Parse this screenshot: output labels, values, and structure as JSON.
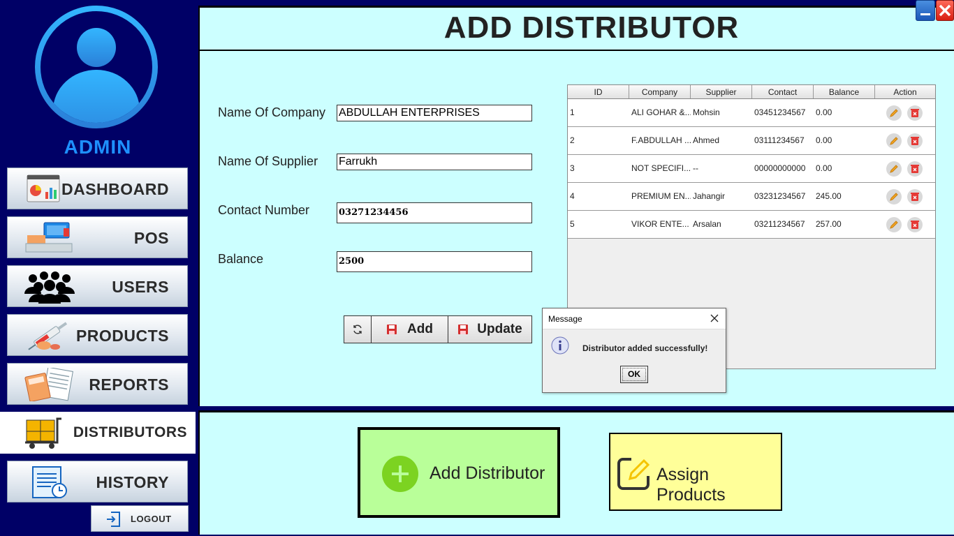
{
  "sidebar": {
    "user_label": "ADMIN",
    "items": [
      {
        "label": "DASHBOARD",
        "icon": "dashboard-icon"
      },
      {
        "label": "POS",
        "icon": "pos-register-icon"
      },
      {
        "label": "USERS",
        "icon": "users-group-icon"
      },
      {
        "label": "PRODUCTS",
        "icon": "medicine-syringe-icon"
      },
      {
        "label": "REPORTS",
        "icon": "calculator-report-icon"
      },
      {
        "label": "DISTRIBUTORS",
        "icon": "delivery-cart-icon",
        "active": true
      },
      {
        "label": "HISTORY",
        "icon": "history-receipt-icon"
      }
    ],
    "logout_label": "LOGOUT"
  },
  "page": {
    "title": "ADD DISTRIBUTOR"
  },
  "form": {
    "company_label": "Name Of Company",
    "company_value": "ABDULLAH ENTERPRISES",
    "supplier_label": "Name Of Supplier",
    "supplier_value": "Farrukh",
    "contact_label": "Contact Number",
    "contact_value": "03271234456",
    "balance_label": "Balance",
    "balance_value": "2500",
    "add_label": "Add",
    "update_label": "Update"
  },
  "table": {
    "columns": [
      "ID",
      "Company",
      "Supplier",
      "Contact",
      "Balance",
      "Action"
    ],
    "rows": [
      {
        "id": "1",
        "company": "ALI GOHAR &...",
        "supplier": "Mohsin",
        "contact": "03451234567",
        "balance": "0.00"
      },
      {
        "id": "2",
        "company": "F.ABDULLAH ...",
        "supplier": "Ahmed",
        "contact": "03111234567",
        "balance": "0.00"
      },
      {
        "id": "3",
        "company": "NOT SPECIFI...",
        "supplier": "--",
        "contact": "00000000000",
        "balance": "0.00"
      },
      {
        "id": "4",
        "company": "PREMIUM EN...",
        "supplier": "Jahangir",
        "contact": "03231234567",
        "balance": "245.00"
      },
      {
        "id": "5",
        "company": "VIKOR ENTE...",
        "supplier": "Arsalan",
        "contact": "03211234567",
        "balance": "257.00"
      }
    ]
  },
  "dialog": {
    "title": "Message",
    "message": "Distributor added successfully!",
    "ok_label": "OK"
  },
  "bottom": {
    "add_distributor_label": "Add Distributor",
    "assign_products_label": "Assign Products"
  },
  "colors": {
    "sidebar_bg": "#000066",
    "panel_bg": "#ccffff",
    "admin_text": "#1e90ff",
    "add_btn_bg": "#b9ff99",
    "assign_btn_bg": "#ffff99"
  }
}
